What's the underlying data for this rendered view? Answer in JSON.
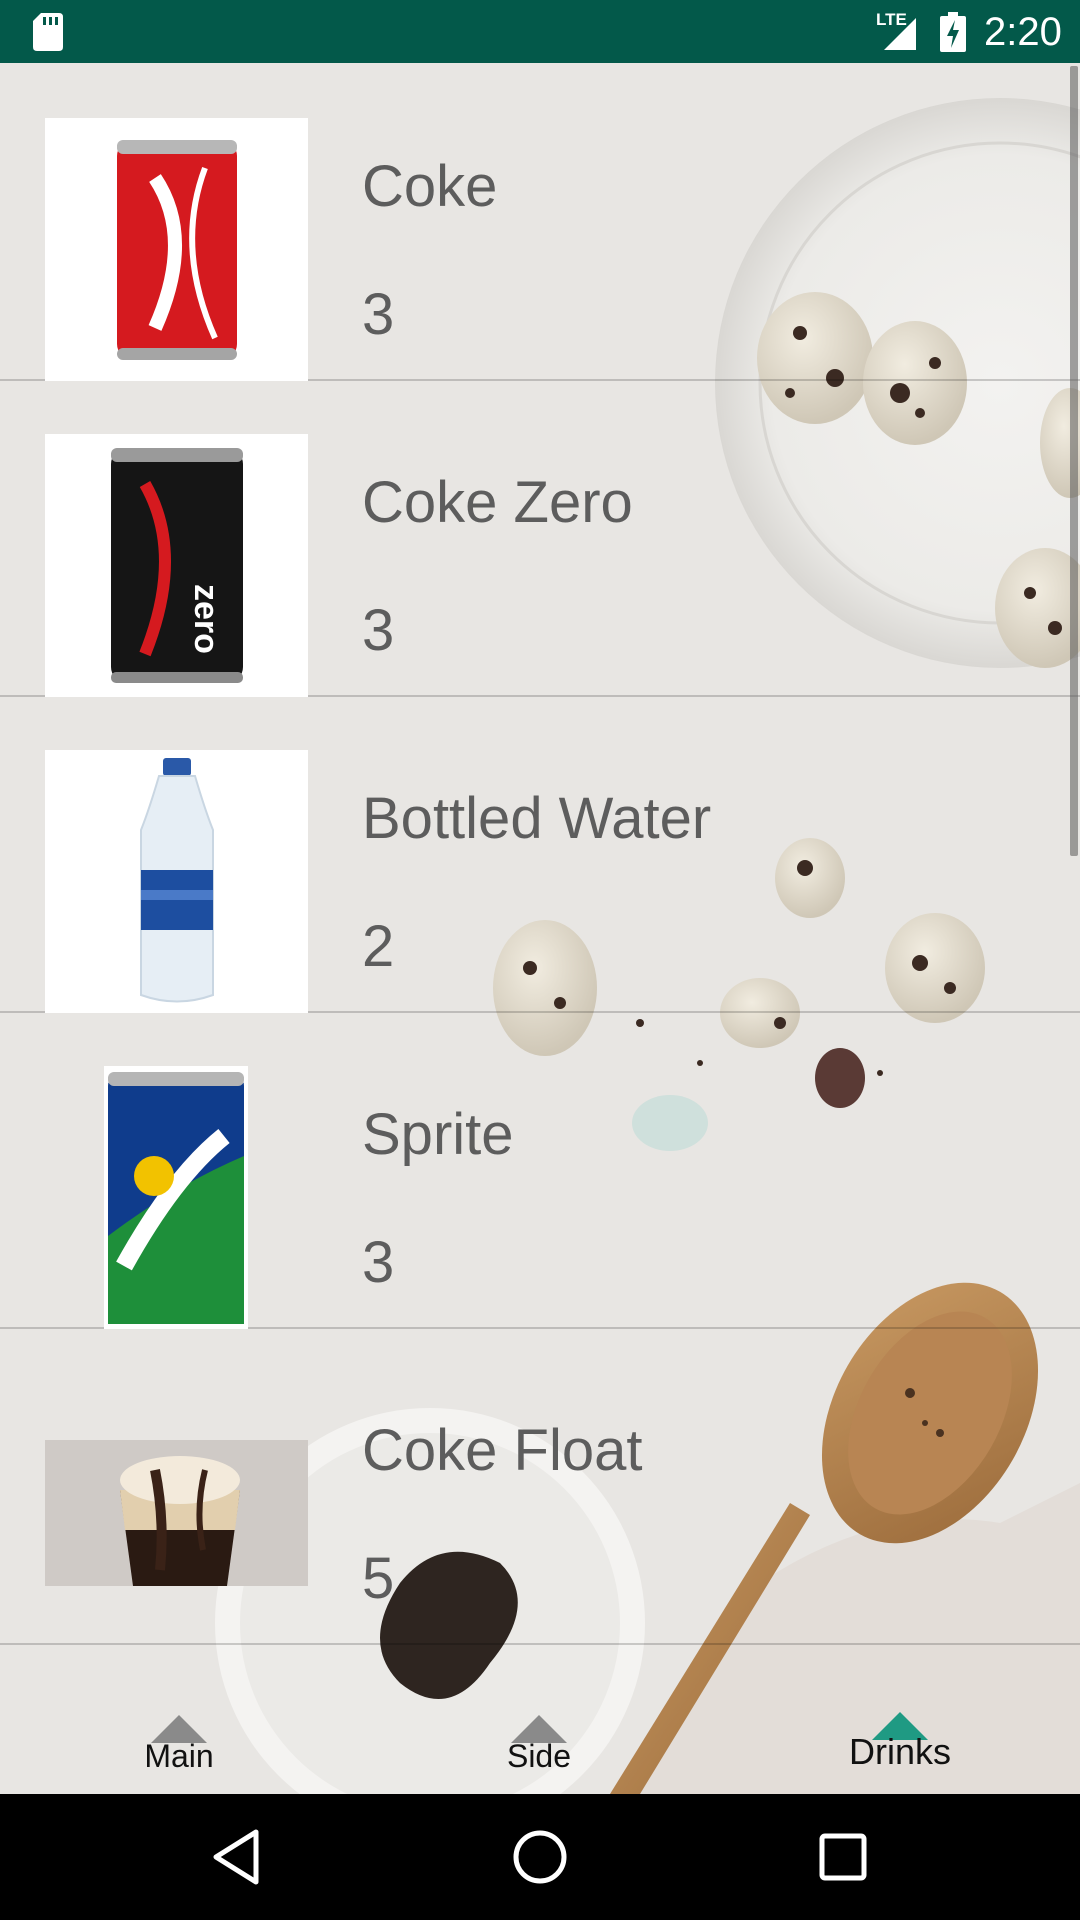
{
  "status_bar": {
    "network": "LTE",
    "time": "2:20"
  },
  "menu": {
    "items": [
      {
        "name": "Coke",
        "price": "3",
        "image": "coke-can"
      },
      {
        "name": "Coke Zero",
        "price": "3",
        "image": "coke-zero-can"
      },
      {
        "name": "Bottled Water",
        "price": "2",
        "image": "aquafina-bottle"
      },
      {
        "name": "Sprite",
        "price": "3",
        "image": "sprite-can"
      },
      {
        "name": "Coke Float",
        "price": "5",
        "image": "coke-float-glass"
      }
    ]
  },
  "bottom_nav": {
    "tabs": [
      {
        "label": "Main",
        "active": false
      },
      {
        "label": "Side",
        "active": false
      },
      {
        "label": "Drinks",
        "active": true
      }
    ]
  },
  "colors": {
    "status_bar": "#03594a",
    "active_tab": "#1f9a83",
    "text": "#5d5d5d"
  }
}
